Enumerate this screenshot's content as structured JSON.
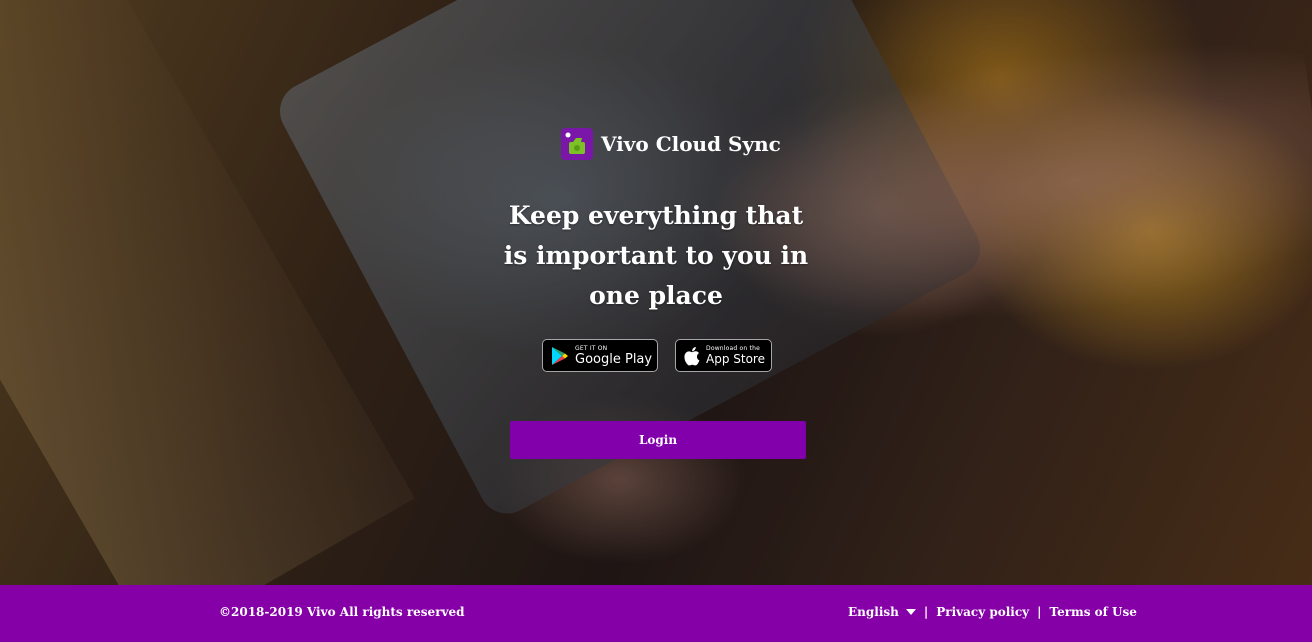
{
  "brand": {
    "name": "Vivo Cloud Sync"
  },
  "hero": {
    "headline": "Keep everything that is important to you in one place"
  },
  "stores": {
    "google": {
      "small": "GET IT ON",
      "big": "Google Play"
    },
    "apple": {
      "small": "Download on the",
      "big": "App Store"
    }
  },
  "login": {
    "label": "Login"
  },
  "footer": {
    "copyright_symbol": "©",
    "copyright": "2018-2019 Vivo All rights reserved",
    "language": "English",
    "separator": "|",
    "privacy": "Privacy policy",
    "terms": "Terms of Use"
  },
  "colors": {
    "accent": "#8600a8",
    "button": "#8200ac"
  }
}
